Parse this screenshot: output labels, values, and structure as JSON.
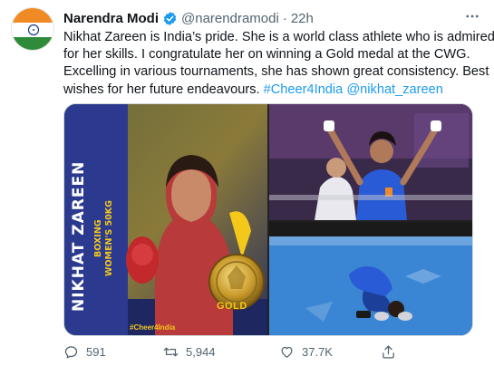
{
  "author": {
    "display_name": "Narendra Modi",
    "handle": "@narendramodi",
    "separator": "·",
    "time": "22h",
    "verified": true,
    "avatar": "indian-flag-avatar"
  },
  "tweet": {
    "lines": [
      "Nikhat Zareen is India’s pride. She is a world class athlete who is admired",
      "for her skills. I congratulate her on winning a Gold medal at the CWG.",
      "Excelling in various tournaments, she has shown great consistency. Best",
      "wishes for her future endeavours."
    ],
    "hashtag": "#Cheer4India",
    "mention": "@nikhat_zareen"
  },
  "media": {
    "poster": {
      "name": "NIKHAT ZAREEN",
      "event_line1": "BOXING",
      "event_line2": "WOMEN'S 50KG",
      "hashtag": "#Cheer4India",
      "medal": "GOLD"
    }
  },
  "actions": {
    "replies": "591",
    "retweets": "5,944",
    "likes": "37.7K"
  },
  "colors": {
    "link": "#1d9bf0",
    "verified": "#1d9bf0",
    "muted": "#536471",
    "poster_blue": "#2b3a8f",
    "poster_yellow": "#f3c81b"
  }
}
